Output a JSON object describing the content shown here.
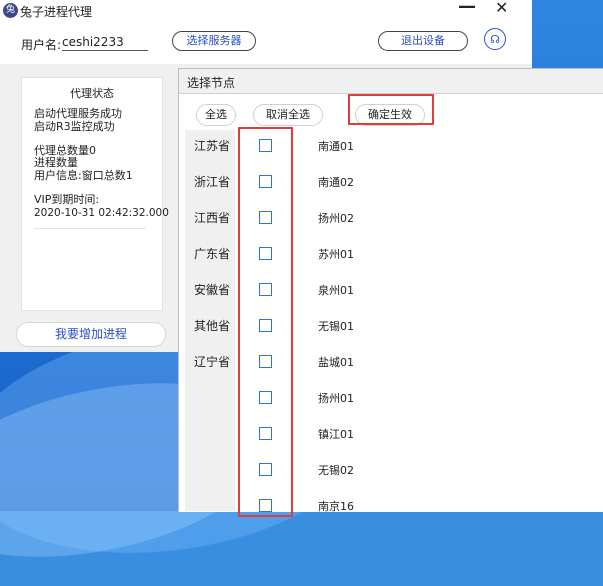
{
  "app": {
    "title": "兔子进程代理",
    "logo_text": "兔",
    "minimize_glyph": "—",
    "close_glyph": "✕",
    "username_label": "用户名:",
    "username_value": "ceshi2233",
    "select_server_label": "选择服务器",
    "logout_label": "退出设备",
    "support_icon": "headset-icon",
    "support_glyph": "☊",
    "status": {
      "title": "代理状态",
      "line1": "启动代理服务成功",
      "line2": "启动R3监控成功",
      "line3": "代理总数量0",
      "line4": "进程数量",
      "line5": "用户信息:窗口总数1",
      "line6": "VIP到期时间:",
      "line7": "2020-10-31 02:42:32.000"
    },
    "add_process_label": "我要增加进程"
  },
  "dialog": {
    "title": "选择节点",
    "select_all_label": "全选",
    "unselect_all_label": "取消全选",
    "confirm_label": "确定生效",
    "provinces": [
      "江苏省",
      "浙江省",
      "江西省",
      "广东省",
      "安徽省",
      "其他省",
      "辽宁省"
    ],
    "nodes": [
      "南通01",
      "南通02",
      "扬州02",
      "苏州01",
      "泉州01",
      "无锡01",
      "盐城01",
      "扬州01",
      "镇江01",
      "无锡02",
      "南京16"
    ]
  },
  "colors": {
    "accent_blue": "#2a4ec8",
    "highlight_red": "#e03c3c",
    "checkbox_border": "#2f72d8"
  }
}
